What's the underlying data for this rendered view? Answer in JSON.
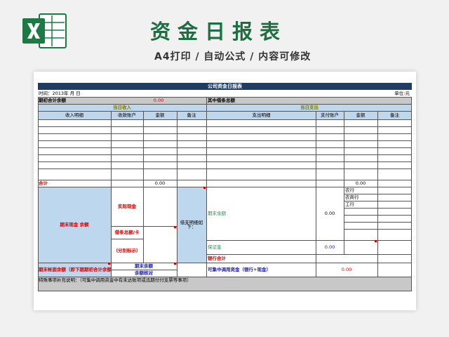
{
  "header": {
    "title": "资金日报表",
    "subtitle": "A4打印 / 自动公式 / 内容可修改"
  },
  "sheet": {
    "banner_title": "公司资金日报表",
    "date_label": "时间：2013年 月 日",
    "unit_label": "单位:元",
    "prev_total_label": "期初合计余额",
    "prev_total_value": "0.00",
    "bill_total_label": "其中借条总额",
    "income_header": "当日收入",
    "expense_header": "当日支出",
    "income_cols": [
      "收入明细",
      "收款账户",
      "金额",
      "备注"
    ],
    "expense_cols": [
      "支出明细",
      "支付账户",
      "金额",
      "备注"
    ],
    "total_label": "合计",
    "income_total": "0.00",
    "expense_total": "0.00",
    "cash_label": "期末现金    余额",
    "actual_cash": "实际现金",
    "bill_card": "借条总额/卡",
    "by_detail": "（分别标示）",
    "expense_detail_mid": "借支明细如下：",
    "end_balance": "期末余额",
    "end_balance_value": "0.00",
    "deposit": "保证金",
    "deposit_value": "0.00",
    "banks": [
      "农行",
      "农商行",
      "工行"
    ],
    "bank_total": "银行合计",
    "book_balance_label": "期末帐面余额（即下期期初合计余额）",
    "end_total": "期末余额",
    "balance_check": "余额核对",
    "available_label": "可集中调用资金（银行+现金）",
    "available_value": "0.00",
    "note": "特殊事项补充说明：（可集中调用资金中有未达账项或迅期付付支票等事项）"
  },
  "colors": {
    "brand_green": "#1f6e41",
    "navy": "#1f3d63",
    "light_blue": "#bdd7ee",
    "grey": "#c8c8c8",
    "red": "#d00000"
  },
  "icons": {
    "logo": "excel-logo-icon"
  }
}
